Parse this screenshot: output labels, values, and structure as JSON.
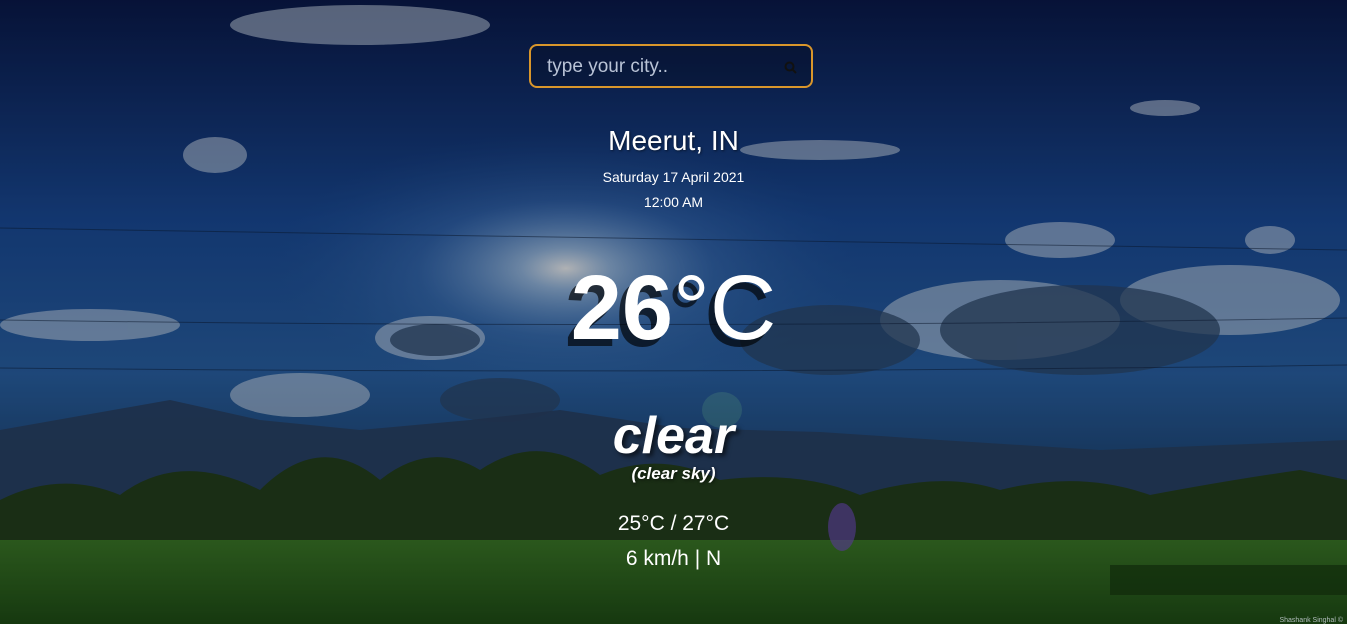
{
  "search": {
    "placeholder": "type your city..",
    "value": "",
    "icon": "search-icon"
  },
  "location": {
    "city_country": "Meerut, IN",
    "date": "Saturday 17 April 2021",
    "time": "12:00 AM"
  },
  "weather": {
    "temp_value": "26",
    "temp_unit": "°C",
    "main": "clear",
    "description": "(clear sky)",
    "min_max": "25°C / 27°C",
    "wind": "6 km/h | N"
  },
  "credit": "Shashank Singhal ©",
  "colors": {
    "search_border": "#d9962b",
    "sky_top": "#0b1f5c",
    "sky_mid": "#1d57a8",
    "grass": "#2d6a1e"
  }
}
